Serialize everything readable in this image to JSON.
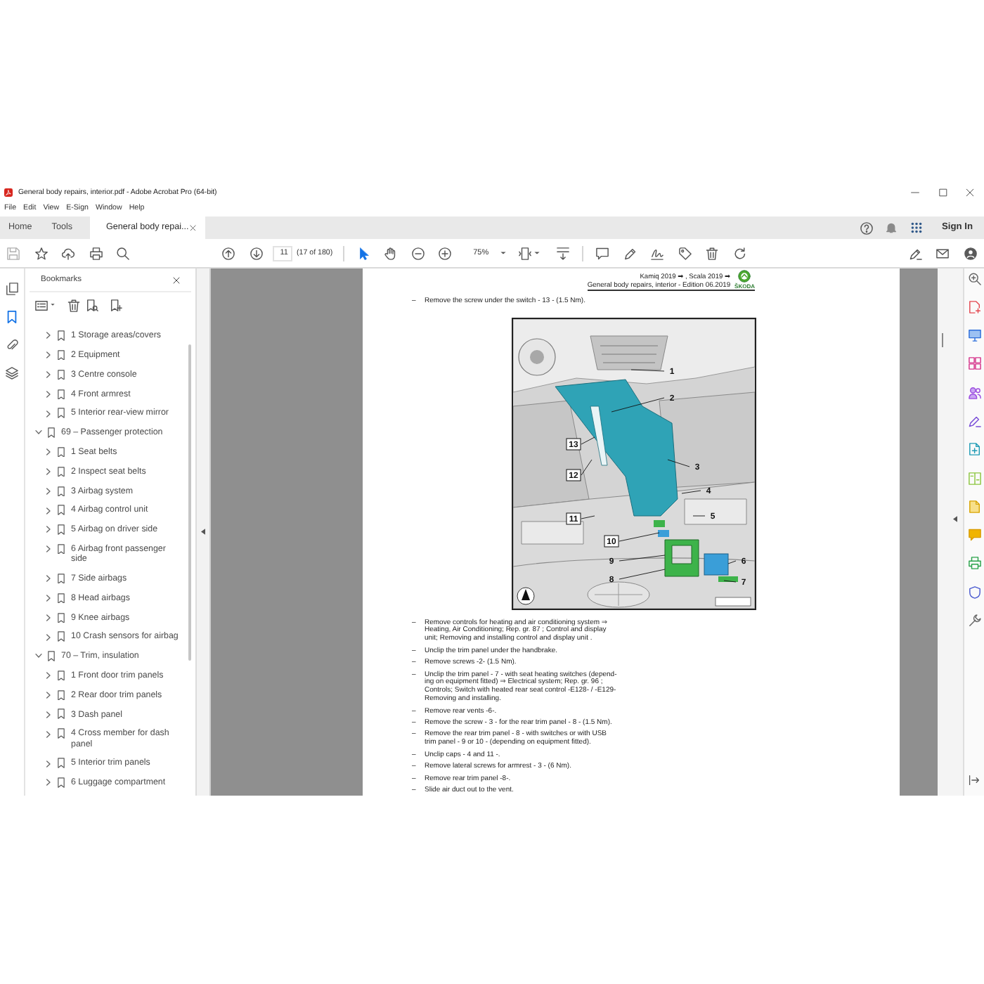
{
  "window": {
    "title": "General body repairs, interior.pdf - Adobe Acrobat Pro (64-bit)"
  },
  "menu": [
    "File",
    "Edit",
    "View",
    "E-Sign",
    "Window",
    "Help"
  ],
  "tabs": [
    {
      "label": "Home",
      "selected": false
    },
    {
      "label": "Tools",
      "selected": false
    },
    {
      "label": "General body repai...",
      "selected": true
    }
  ],
  "account": {
    "sign_in": "Sign In"
  },
  "toolbar": {
    "page_field": "11",
    "page_count": "(17 of 180)",
    "zoom": "75%"
  },
  "side_rail": [
    {
      "selected": false
    },
    {
      "selected": true
    },
    {
      "selected": false
    },
    {
      "selected": false
    }
  ],
  "bookmarks": {
    "title": "Bookmarks",
    "items": [
      {
        "children": [
          {
            "label": "1 Storage areas/covers",
            "expanded": false
          },
          {
            "label": "2 Equipment",
            "expanded": false
          },
          {
            "label": "3 Centre console",
            "expanded": false
          },
          {
            "label": "4 Front armrest",
            "expanded": false
          },
          {
            "label": "5 Interior rear-view mirror",
            "expanded": false
          }
        ]
      },
      {
        "label": "69 – Passenger protection",
        "expanded": true,
        "children": [
          {
            "label": "1 Seat belts",
            "expanded": false
          },
          {
            "label": "2 Inspect seat belts",
            "expanded": false
          },
          {
            "label": "3 Airbag system",
            "expanded": false
          },
          {
            "label": "4 Airbag control unit",
            "expanded": false
          },
          {
            "label": "5 Airbag on driver side",
            "expanded": false
          },
          {
            "label": "6 Airbag front passenger side",
            "expanded": false
          },
          {
            "label": "7 Side airbags",
            "expanded": false
          },
          {
            "label": "8 Head airbags",
            "expanded": false
          },
          {
            "label": "9 Knee airbags",
            "expanded": false
          },
          {
            "label": "10 Crash sensors for airbag",
            "expanded": false
          }
        ]
      },
      {
        "label": "70 – Trim, insulation",
        "expanded": true,
        "children": [
          {
            "label": "1 Front door trim panels",
            "expanded": false
          },
          {
            "label": "2 Rear door trim panels",
            "expanded": false
          },
          {
            "label": "3 Dash panel",
            "expanded": false
          },
          {
            "label": "4 Cross member for dash panel",
            "expanded": false
          },
          {
            "label": "5 Interior trim panels",
            "expanded": false
          },
          {
            "label": "6 Luggage compartment",
            "expanded": false
          }
        ]
      }
    ]
  },
  "document": {
    "header": {
      "models": "Kamiq 2019 ➡ , Scala 2019 ➡",
      "title": "General body repairs, interior - Edition 06.2019",
      "brand": "ŠKODA"
    },
    "steps_before": [
      {
        "bullet": "–",
        "text": "Remove the screw under the switch - 13 - (1.5 Nm)."
      }
    ],
    "figure": {
      "callouts": [
        {
          "label": "1",
          "boxed": false
        },
        {
          "label": "2",
          "boxed": false
        },
        {
          "label": "13",
          "boxed": true
        },
        {
          "label": "3",
          "boxed": false
        },
        {
          "label": "12",
          "boxed": true
        },
        {
          "label": "4",
          "boxed": false
        },
        {
          "label": "5",
          "boxed": false
        },
        {
          "label": "11",
          "boxed": true
        },
        {
          "label": "10",
          "boxed": true
        },
        {
          "label": "9",
          "boxed": false
        },
        {
          "label": "6",
          "boxed": false
        },
        {
          "label": "8",
          "boxed": false
        },
        {
          "label": "7",
          "boxed": false
        }
      ]
    },
    "steps_after": [
      {
        "bullet": "–",
        "text": "Remove controls for heating and air conditioning system ⇒ Heating, Air Conditioning; Rep. gr. 87 ; Control and display unit; Removing and installing control and display unit ."
      },
      {
        "bullet": "–",
        "text": "Unclip the trim panel under the handbrake."
      },
      {
        "bullet": "–",
        "text": "Remove screws -2- (1.5 Nm)."
      },
      {
        "bullet": "–",
        "text": "Unclip the trim panel - 7 - with seat heating switches (depend-ing on equipment fitted) ⇒ Electrical system; Rep. gr. 96 ; Controls; Switch with heated rear seat control -E128- / -E129- Removing and installing."
      },
      {
        "bullet": "–",
        "text": "Remove rear vents -6-."
      },
      {
        "bullet": "–",
        "text": "Remove the screw - 3 - for the rear trim panel - 8 - (1.5 Nm)."
      },
      {
        "bullet": "–",
        "text": "Remove the rear trim panel - 8 - with switches or with USB trim panel - 9 or 10 - (depending on equipment fitted)."
      },
      {
        "bullet": "–",
        "text": "Unclip caps - 4 and 11 -."
      },
      {
        "bullet": "–",
        "text": "Remove lateral screws for armrest - 3 - (6 Nm)."
      },
      {
        "bullet": "–",
        "text": "Remove rear trim panel -8-."
      },
      {
        "bullet": "–",
        "text": "Slide air duct out to the vent."
      }
    ]
  }
}
